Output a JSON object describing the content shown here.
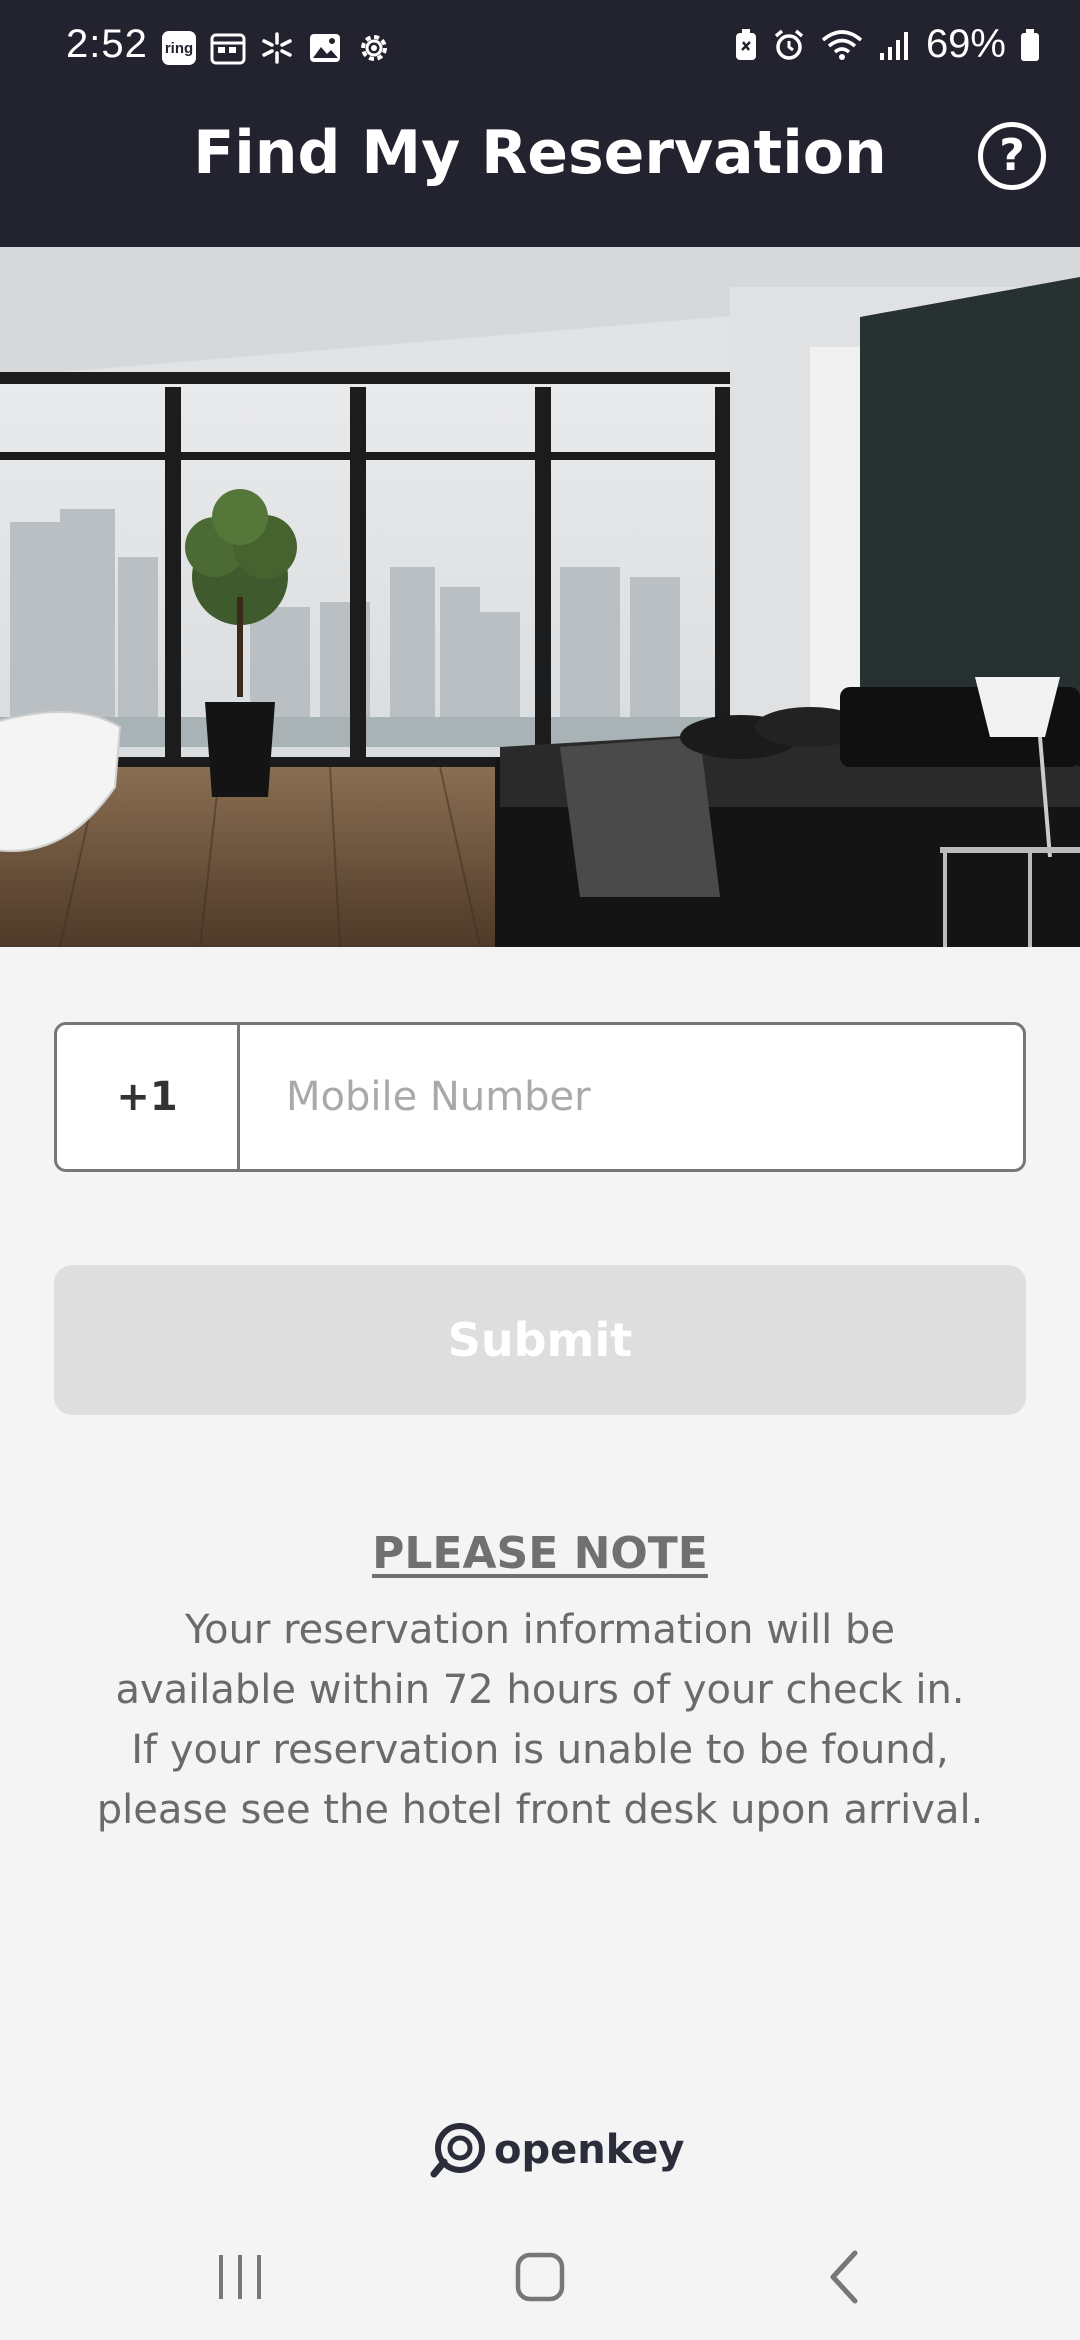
{
  "status_bar": {
    "time": "2:52",
    "notif_icons": [
      "ring-app-icon",
      "calendar-icon",
      "pinwheel-icon",
      "gallery-icon",
      "settings-icon"
    ],
    "ring_label": "ring",
    "system_icons": [
      "battery-saver-icon",
      "alarm-icon",
      "wifi-icon",
      "signal-icon"
    ],
    "battery": "69%"
  },
  "header": {
    "title": "Find My Reservation",
    "help_icon": "help-circle-icon",
    "help_symbol": "?"
  },
  "hero": {
    "alt": "hotel-room-image"
  },
  "form": {
    "country_code": "+1",
    "mobile_placeholder": "Mobile Number",
    "mobile_value": "",
    "submit_label": "Submit"
  },
  "note": {
    "title": "PLEASE NOTE",
    "line1": "Your reservation information will be",
    "line2": "available within 72 hours of your check in.",
    "line3": "If your reservation is unable to be found,",
    "line4": "please see the hotel front desk upon arrival."
  },
  "branding": {
    "logo_icon": "openkey-logo-icon",
    "name": "openkey"
  },
  "nav_bar": {
    "icons": [
      "recent-apps-icon",
      "home-icon",
      "back-icon"
    ]
  },
  "colors": {
    "header_bg": "#22232f",
    "page_bg": "#f4f4f4",
    "submit_disabled": "#dedede",
    "text_gray": "#6a6a6a"
  }
}
